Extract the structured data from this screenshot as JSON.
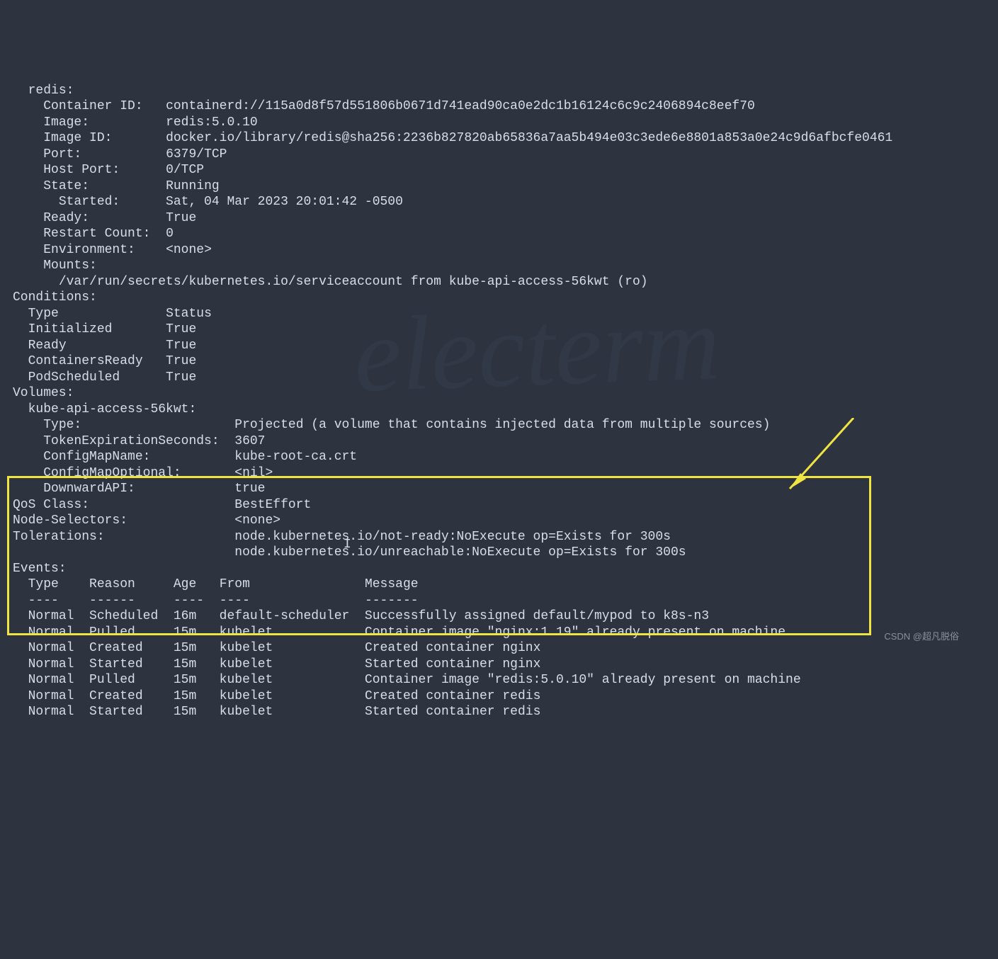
{
  "container": {
    "name": "redis:",
    "container_id_label": "Container ID:",
    "container_id_value": "containerd://115a0d8f57d551806b0671d741ead90ca0e2dc1b16124c6c9c2406894c8eef70",
    "image_label": "Image:",
    "image_value": "redis:5.0.10",
    "image_id_label": "Image ID:",
    "image_id_value": "docker.io/library/redis@sha256:2236b827820ab65836a7aa5b494e03c3ede6e8801a853a0e24c9d6afbcfe0461",
    "port_label": "Port:",
    "port_value": "6379/TCP",
    "host_port_label": "Host Port:",
    "host_port_value": "0/TCP",
    "state_label": "State:",
    "state_value": "Running",
    "started_label": "Started:",
    "started_value": "Sat, 04 Mar 2023 20:01:42 -0500",
    "ready_label": "Ready:",
    "ready_value": "True",
    "restart_count_label": "Restart Count:",
    "restart_count_value": "0",
    "environment_label": "Environment:",
    "environment_value": "<none>",
    "mounts_label": "Mounts:",
    "mounts_value": "/var/run/secrets/kubernetes.io/serviceaccount from kube-api-access-56kwt (ro)"
  },
  "conditions": {
    "header": "Conditions:",
    "type_header": "Type",
    "status_header": "Status",
    "rows": [
      {
        "type": "Initialized",
        "status": "True"
      },
      {
        "type": "Ready",
        "status": "True"
      },
      {
        "type": "ContainersReady",
        "status": "True"
      },
      {
        "type": "PodScheduled",
        "status": "True"
      }
    ]
  },
  "volumes": {
    "header": "Volumes:",
    "name": "kube-api-access-56kwt:",
    "type_label": "Type:",
    "type_value": "Projected (a volume that contains injected data from multiple sources)",
    "token_exp_label": "TokenExpirationSeconds:",
    "token_exp_value": "3607",
    "configmap_name_label": "ConfigMapName:",
    "configmap_name_value": "kube-root-ca.crt",
    "configmap_optional_label": "ConfigMapOptional:",
    "configmap_optional_value": "<nil>",
    "downward_api_label": "DownwardAPI:",
    "downward_api_value": "true"
  },
  "qos": {
    "label": "QoS Class:",
    "value": "BestEffort"
  },
  "node_selectors": {
    "label": "Node-Selectors:",
    "value": "<none>"
  },
  "tolerations": {
    "label": "Tolerations:",
    "value1": "node.kubernetes.io/not-ready:NoExecute op=Exists for 300s",
    "value2": "node.kubernetes.io/unreachable:NoExecute op=Exists for 300s"
  },
  "events": {
    "header": "Events:",
    "columns": {
      "type": "Type",
      "reason": "Reason",
      "age": "Age",
      "from": "From",
      "message": "Message"
    },
    "separators": {
      "type": "----",
      "reason": "------",
      "age": "----",
      "from": "----",
      "message": "-------"
    },
    "rows": [
      {
        "type": "Normal",
        "reason": "Scheduled",
        "age": "16m",
        "from": "default-scheduler",
        "message": "Successfully assigned default/mypod to k8s-n3"
      },
      {
        "type": "Normal",
        "reason": "Pulled",
        "age": "15m",
        "from": "kubelet",
        "message": "Container image \"nginx:1.19\" already present on machine"
      },
      {
        "type": "Normal",
        "reason": "Created",
        "age": "15m",
        "from": "kubelet",
        "message": "Created container nginx"
      },
      {
        "type": "Normal",
        "reason": "Started",
        "age": "15m",
        "from": "kubelet",
        "message": "Started container nginx"
      },
      {
        "type": "Normal",
        "reason": "Pulled",
        "age": "15m",
        "from": "kubelet",
        "message": "Container image \"redis:5.0.10\" already present on machine"
      },
      {
        "type": "Normal",
        "reason": "Created",
        "age": "15m",
        "from": "kubelet",
        "message": "Created container redis"
      },
      {
        "type": "Normal",
        "reason": "Started",
        "age": "15m",
        "from": "kubelet",
        "message": "Started container redis"
      }
    ]
  },
  "footer": "CSDN @超凡脱俗",
  "watermark": "electerm"
}
